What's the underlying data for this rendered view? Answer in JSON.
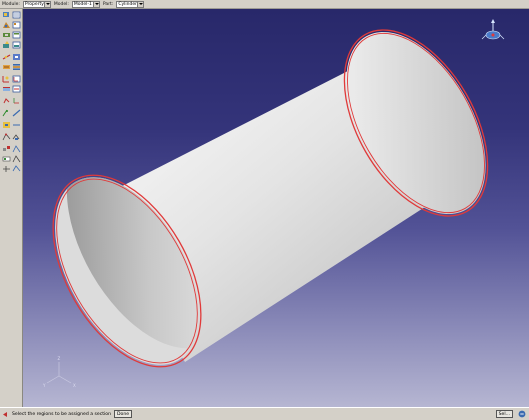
{
  "context_bar": {
    "module_label": "Module:",
    "module_value": "Property",
    "model_label": "Model:",
    "model_value": "Model-1",
    "part_label": "Part:",
    "part_value": "Cylinder"
  },
  "toolbox": {
    "icons": [
      "create-section-icon",
      "section-manager-icon",
      "create-material-icon",
      "material-manager-icon",
      "create-profile-icon",
      "profile-manager-icon",
      "assign-section-icon",
      "section-assignment-manager-icon",
      "assign-beam-orientation-icon",
      "beam-section-plot-icon",
      "assign-rebar-icon",
      "composite-layup-icon",
      "assign-material-orientation-icon",
      "orientation-manager-icon",
      "skin-icon",
      "stringer-icon",
      "special-icon",
      "datum-csys-icon",
      "partition-icon",
      "query-icon",
      "datum-point-icon",
      "datum-axis-icon",
      "view-cut-icon",
      "view-manager-icon"
    ]
  },
  "status_bar": {
    "prompt": "Select the regions to be assigned a section",
    "done_label": "Done",
    "right_button_label": "Sel..."
  },
  "viewport": {
    "background_top": "#28286a",
    "background_bottom": "#b6b6d2",
    "edge_highlight_color": "#e03a3a",
    "triad_labels": [
      "X",
      "Y",
      "Z"
    ]
  }
}
